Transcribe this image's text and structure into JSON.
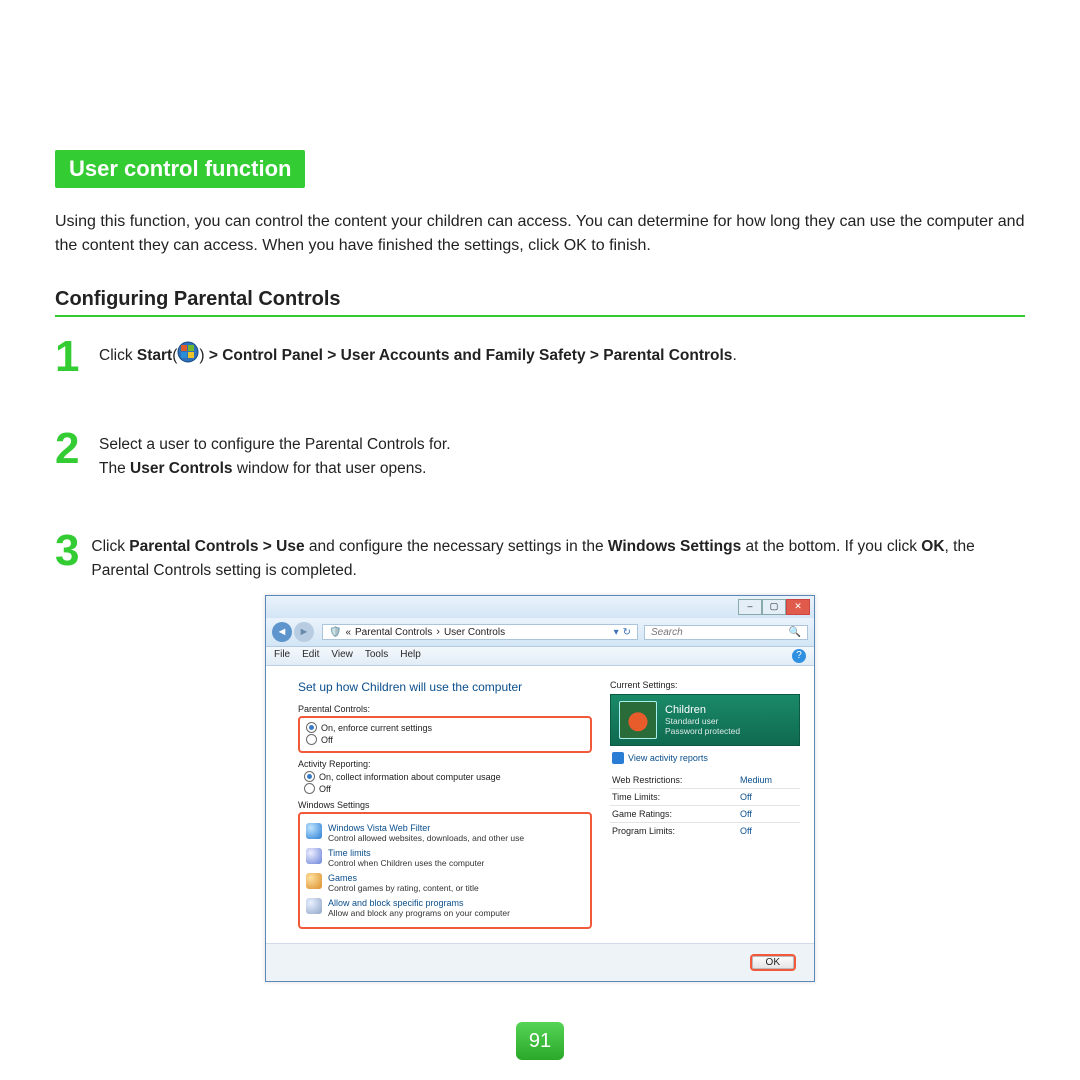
{
  "title": "User control function",
  "intro": "Using this function, you can control the content your children can access. You can determine for how long they can use the computer and the content they can access. When you have finished the settings, click OK to finish.",
  "section": "Configuring Parental Controls",
  "steps": {
    "s1_a": "Click ",
    "s1_b": "Start",
    "s1_c": " > Control Panel > User Accounts and Family Safety > Parental Controls",
    "s1_d": ".",
    "s2_a": "Select a user to configure the Parental Controls for.",
    "s2_b1": "The ",
    "s2_b2": "User Controls",
    "s2_b3": " window for that user opens.",
    "s3_a": "Click ",
    "s3_b": "Parental Controls > Use",
    "s3_c": " and configure the necessary settings in the ",
    "s3_d": "Windows Settings",
    "s3_e": " at the bottom. If you click ",
    "s3_f": "OK",
    "s3_g": ", the Parental Controls setting is completed."
  },
  "numbers": {
    "n1": "1",
    "n2": "2",
    "n3": "3"
  },
  "page_number": "91",
  "win": {
    "crumb_prefix": "«",
    "crumb1": "Parental Controls",
    "crumb_sep": "›",
    "crumb2": "User Controls",
    "search_placeholder": "Search",
    "menu": [
      "File",
      "Edit",
      "View",
      "Tools",
      "Help"
    ],
    "setup_title": "Set up how Children will use the computer",
    "pc_group": "Parental Controls:",
    "pc_on": "On, enforce current settings",
    "pc_off": "Off",
    "ar_group": "Activity Reporting:",
    "ar_on": "On, collect information about computer usage",
    "ar_off": "Off",
    "ws_heading": "Windows Settings",
    "ws": [
      {
        "link": "Windows Vista Web Filter",
        "desc": "Control allowed websites, downloads, and other use"
      },
      {
        "link": "Time limits",
        "desc": "Control when Children uses the computer"
      },
      {
        "link": "Games",
        "desc": "Control games by rating, content, or title"
      },
      {
        "link": "Allow and block specific programs",
        "desc": "Allow and block any programs on your computer"
      }
    ],
    "cs_label": "Current Settings:",
    "user": {
      "name": "Children",
      "type": "Standard user",
      "pw": "Password protected"
    },
    "view_link": "View activity reports",
    "rows": [
      {
        "k": "Web Restrictions:",
        "v": "Medium"
      },
      {
        "k": "Time Limits:",
        "v": "Off"
      },
      {
        "k": "Game Ratings:",
        "v": "Off"
      },
      {
        "k": "Program Limits:",
        "v": "Off"
      }
    ],
    "ok": "OK"
  }
}
